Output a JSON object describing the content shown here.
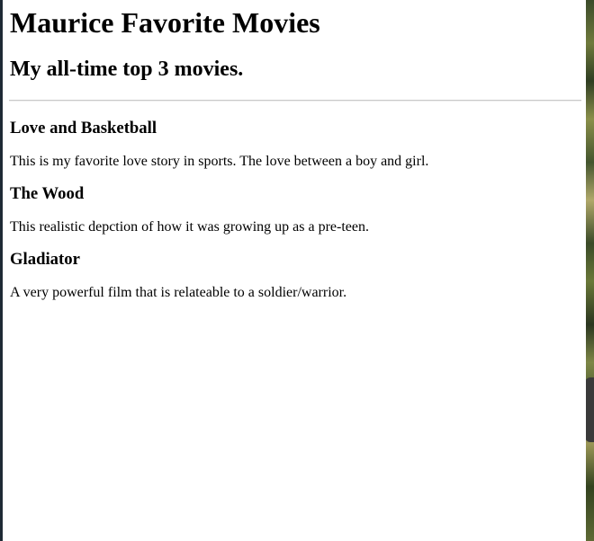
{
  "page": {
    "title": "Maurice Favorite Movies",
    "subtitle": "My all-time top 3 movies."
  },
  "movies": [
    {
      "title": "Love and Basketball",
      "description": "This is my favorite love story in sports. The love between a boy and girl."
    },
    {
      "title": "The Wood",
      "description": "This realistic depction of how it was growing up as a pre-teen."
    },
    {
      "title": "Gladiator",
      "description": "A very powerful film that is relateable to a soldier/warrior."
    }
  ]
}
